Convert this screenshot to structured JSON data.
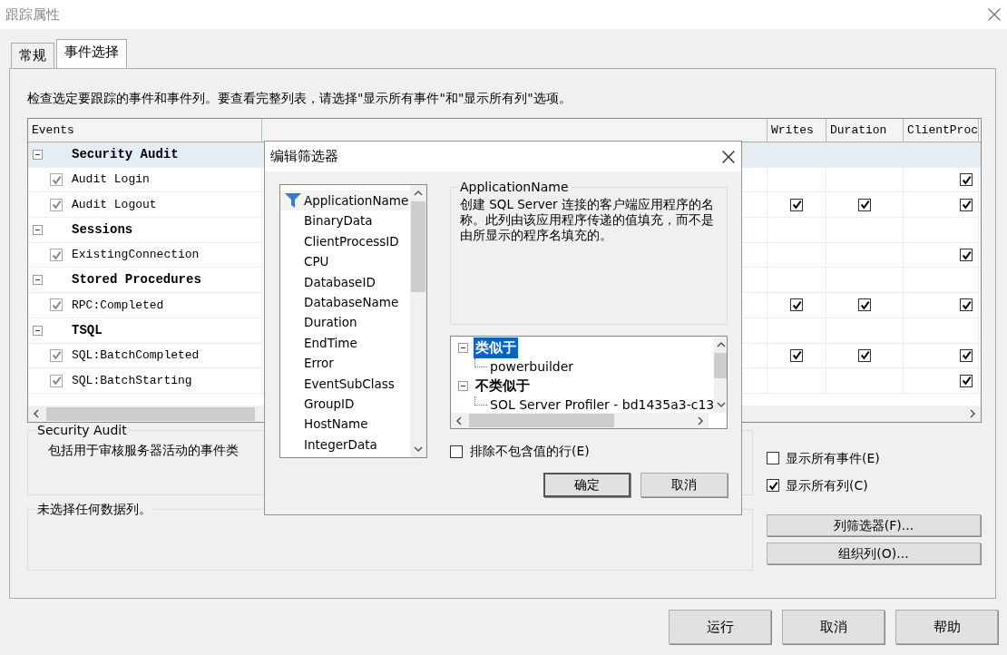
{
  "window": {
    "title": "跟踪属性"
  },
  "tabs": [
    {
      "label": "常规",
      "selected": false
    },
    {
      "label": "事件选择",
      "selected": true
    }
  ],
  "instruction": "检查选定要跟踪的事件和事件列。要查看完整列表，请选择\"显示所有事件\"和\"显示所有列\"选项。",
  "events_grid": {
    "columns": [
      "Events",
      "Writes",
      "Duration",
      "ClientProc"
    ],
    "groups": [
      {
        "name": "Security Audit",
        "expanded": true,
        "selected": true,
        "events": [
          {
            "name": "Audit Login",
            "checked": true,
            "cells": [
              {
                "checked": false
              },
              {
                "checked": false
              },
              {
                "checked": true
              }
            ]
          },
          {
            "name": "Audit Logout",
            "checked": true,
            "cells": [
              {
                "checked": true
              },
              {
                "checked": true
              },
              {
                "checked": true
              }
            ]
          }
        ]
      },
      {
        "name": "Sessions",
        "expanded": true,
        "selected": false,
        "events": [
          {
            "name": "ExistingConnection",
            "checked": true,
            "cells": [
              {
                "checked": false
              },
              {
                "checked": false
              },
              {
                "checked": true
              }
            ]
          }
        ]
      },
      {
        "name": "Stored Procedures",
        "expanded": true,
        "selected": false,
        "events": [
          {
            "name": "RPC:Completed",
            "checked": true,
            "cells": [
              {
                "checked": true
              },
              {
                "checked": true
              },
              {
                "checked": true
              }
            ]
          }
        ]
      },
      {
        "name": "TSQL",
        "expanded": true,
        "selected": false,
        "events": [
          {
            "name": "SQL:BatchCompleted",
            "checked": true,
            "cells": [
              {
                "checked": true
              },
              {
                "checked": true
              },
              {
                "checked": true
              }
            ]
          },
          {
            "name": "SQL:BatchStarting",
            "checked": true,
            "cells": [
              {
                "checked": false
              },
              {
                "checked": false
              },
              {
                "checked": true
              }
            ]
          }
        ]
      }
    ]
  },
  "description": {
    "legend": "Security Audit",
    "text": "包括用于审核服务器活动的事件类"
  },
  "columns_info": {
    "legend": "未选择任何数据列。"
  },
  "options": [
    {
      "label": "显示所有事件(E)",
      "checked": false
    },
    {
      "label": "显示所有列(C)",
      "checked": true
    }
  ],
  "side_buttons": [
    "列筛选器(F)...",
    "组织列(O)..."
  ],
  "footer_buttons": [
    "运行",
    "取消",
    "帮助"
  ],
  "filter_dialog": {
    "title": "编辑筛选器",
    "columns": [
      {
        "label": "ApplicationName",
        "selected": true,
        "filtered": true
      },
      {
        "label": "BinaryData",
        "selected": false,
        "filtered": false
      },
      {
        "label": "ClientProcessID",
        "selected": false,
        "filtered": false
      },
      {
        "label": "CPU",
        "selected": false,
        "filtered": false
      },
      {
        "label": "DatabaseID",
        "selected": false,
        "filtered": false
      },
      {
        "label": "DatabaseName",
        "selected": false,
        "filtered": false
      },
      {
        "label": "Duration",
        "selected": false,
        "filtered": false
      },
      {
        "label": "EndTime",
        "selected": false,
        "filtered": false
      },
      {
        "label": "Error",
        "selected": false,
        "filtered": false
      },
      {
        "label": "EventSubClass",
        "selected": false,
        "filtered": false
      },
      {
        "label": "GroupID",
        "selected": false,
        "filtered": false
      },
      {
        "label": "HostName",
        "selected": false,
        "filtered": false
      },
      {
        "label": "IntegerData",
        "selected": false,
        "filtered": false
      }
    ],
    "description": {
      "legend": "ApplicationName",
      "text": "创建 SQL Server 连接的客户端应用程序的名称。此列由该应用程序传递的值填充，而不是由所显示的程序名填充的。"
    },
    "conditions": [
      {
        "label": "类似于",
        "selected": true,
        "expanded": true,
        "children": [
          {
            "label": "powerbuilder"
          }
        ]
      },
      {
        "label": "不类似于",
        "selected": false,
        "expanded": true,
        "children": [
          {
            "label": "SOL Server Profiler - bd1435a3-c13"
          }
        ]
      }
    ],
    "exclude": {
      "label": "排除不包含值的行(E)",
      "checked": false
    },
    "buttons": [
      {
        "label": "确定",
        "default": true
      },
      {
        "label": "取消",
        "default": false
      }
    ]
  }
}
